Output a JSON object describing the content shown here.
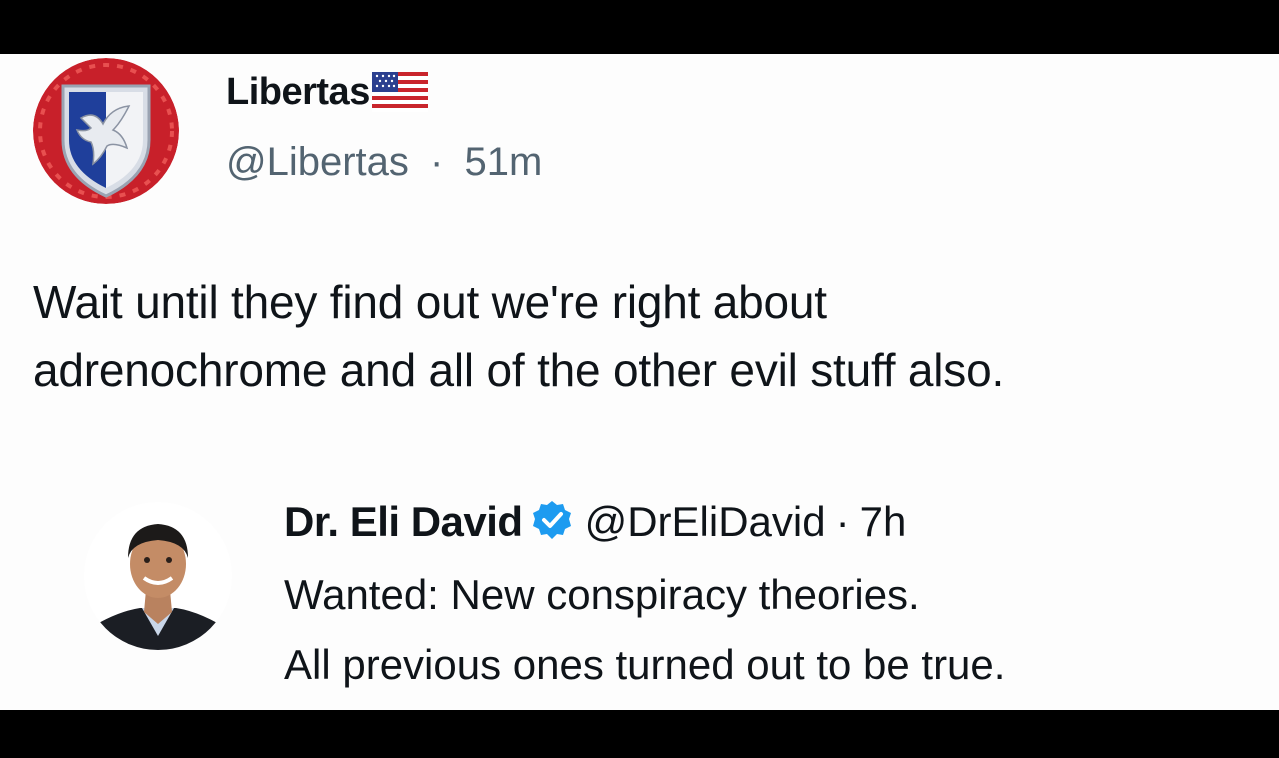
{
  "post": {
    "author": {
      "display_name": "Libertas",
      "flag_icon": "us-flag-icon",
      "handle": "@Libertas",
      "separator": "·",
      "time": "51m"
    },
    "text_lines": [
      "Wait until they find out we're right about",
      "adrenochrome and all of the other evil stuff also."
    ]
  },
  "quoted_post": {
    "author": {
      "display_name": "Dr. Eli David",
      "verified_icon": "verified-badge-icon",
      "handle": "@DrEliDavid",
      "separator": "·",
      "time": "7h"
    },
    "text_lines": [
      "Wanted: New conspiracy theories.",
      "All previous ones turned out to be true."
    ]
  },
  "colors": {
    "background": "#fdfdfd",
    "letterbox": "#000000",
    "text": "#0f1419",
    "muted_text": "#536471",
    "verified_blue": "#1d9bf0"
  }
}
